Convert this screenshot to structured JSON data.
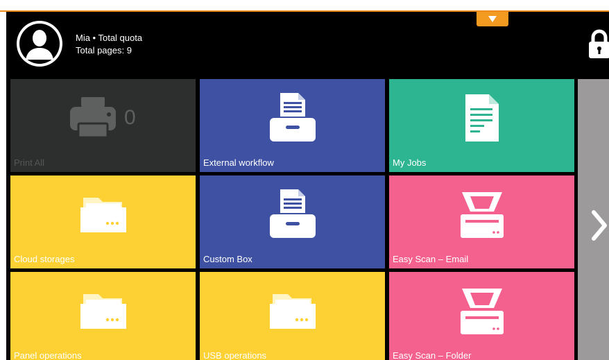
{
  "user": {
    "line1": "Mia • Total quota",
    "line2": "Total pages: 9"
  },
  "colors": {
    "accent_orange": "#f39a21",
    "dark_tile": "#2d2e2e",
    "blue_tile": "#3e51a3",
    "green_tile": "#2db592",
    "yellow_tile": "#fdd133",
    "pink_tile": "#f5618f",
    "side_panel": "#9c9a9b"
  },
  "tiles": [
    {
      "label": "Print All",
      "icon": "printer-icon",
      "count": "0"
    },
    {
      "label": "External workflow",
      "icon": "document-tray-icon"
    },
    {
      "label": "My Jobs",
      "icon": "document-icon"
    },
    {
      "label": "Cloud storages",
      "icon": "folder-icon"
    },
    {
      "label": "Custom Box",
      "icon": "document-tray-icon"
    },
    {
      "label": "Easy Scan – Email",
      "icon": "scanner-icon"
    },
    {
      "label": "Panel operations",
      "icon": "folder-icon"
    },
    {
      "label": "USB operations",
      "icon": "folder-icon"
    },
    {
      "label": "Easy Scan – Folder",
      "icon": "scanner-icon"
    }
  ]
}
